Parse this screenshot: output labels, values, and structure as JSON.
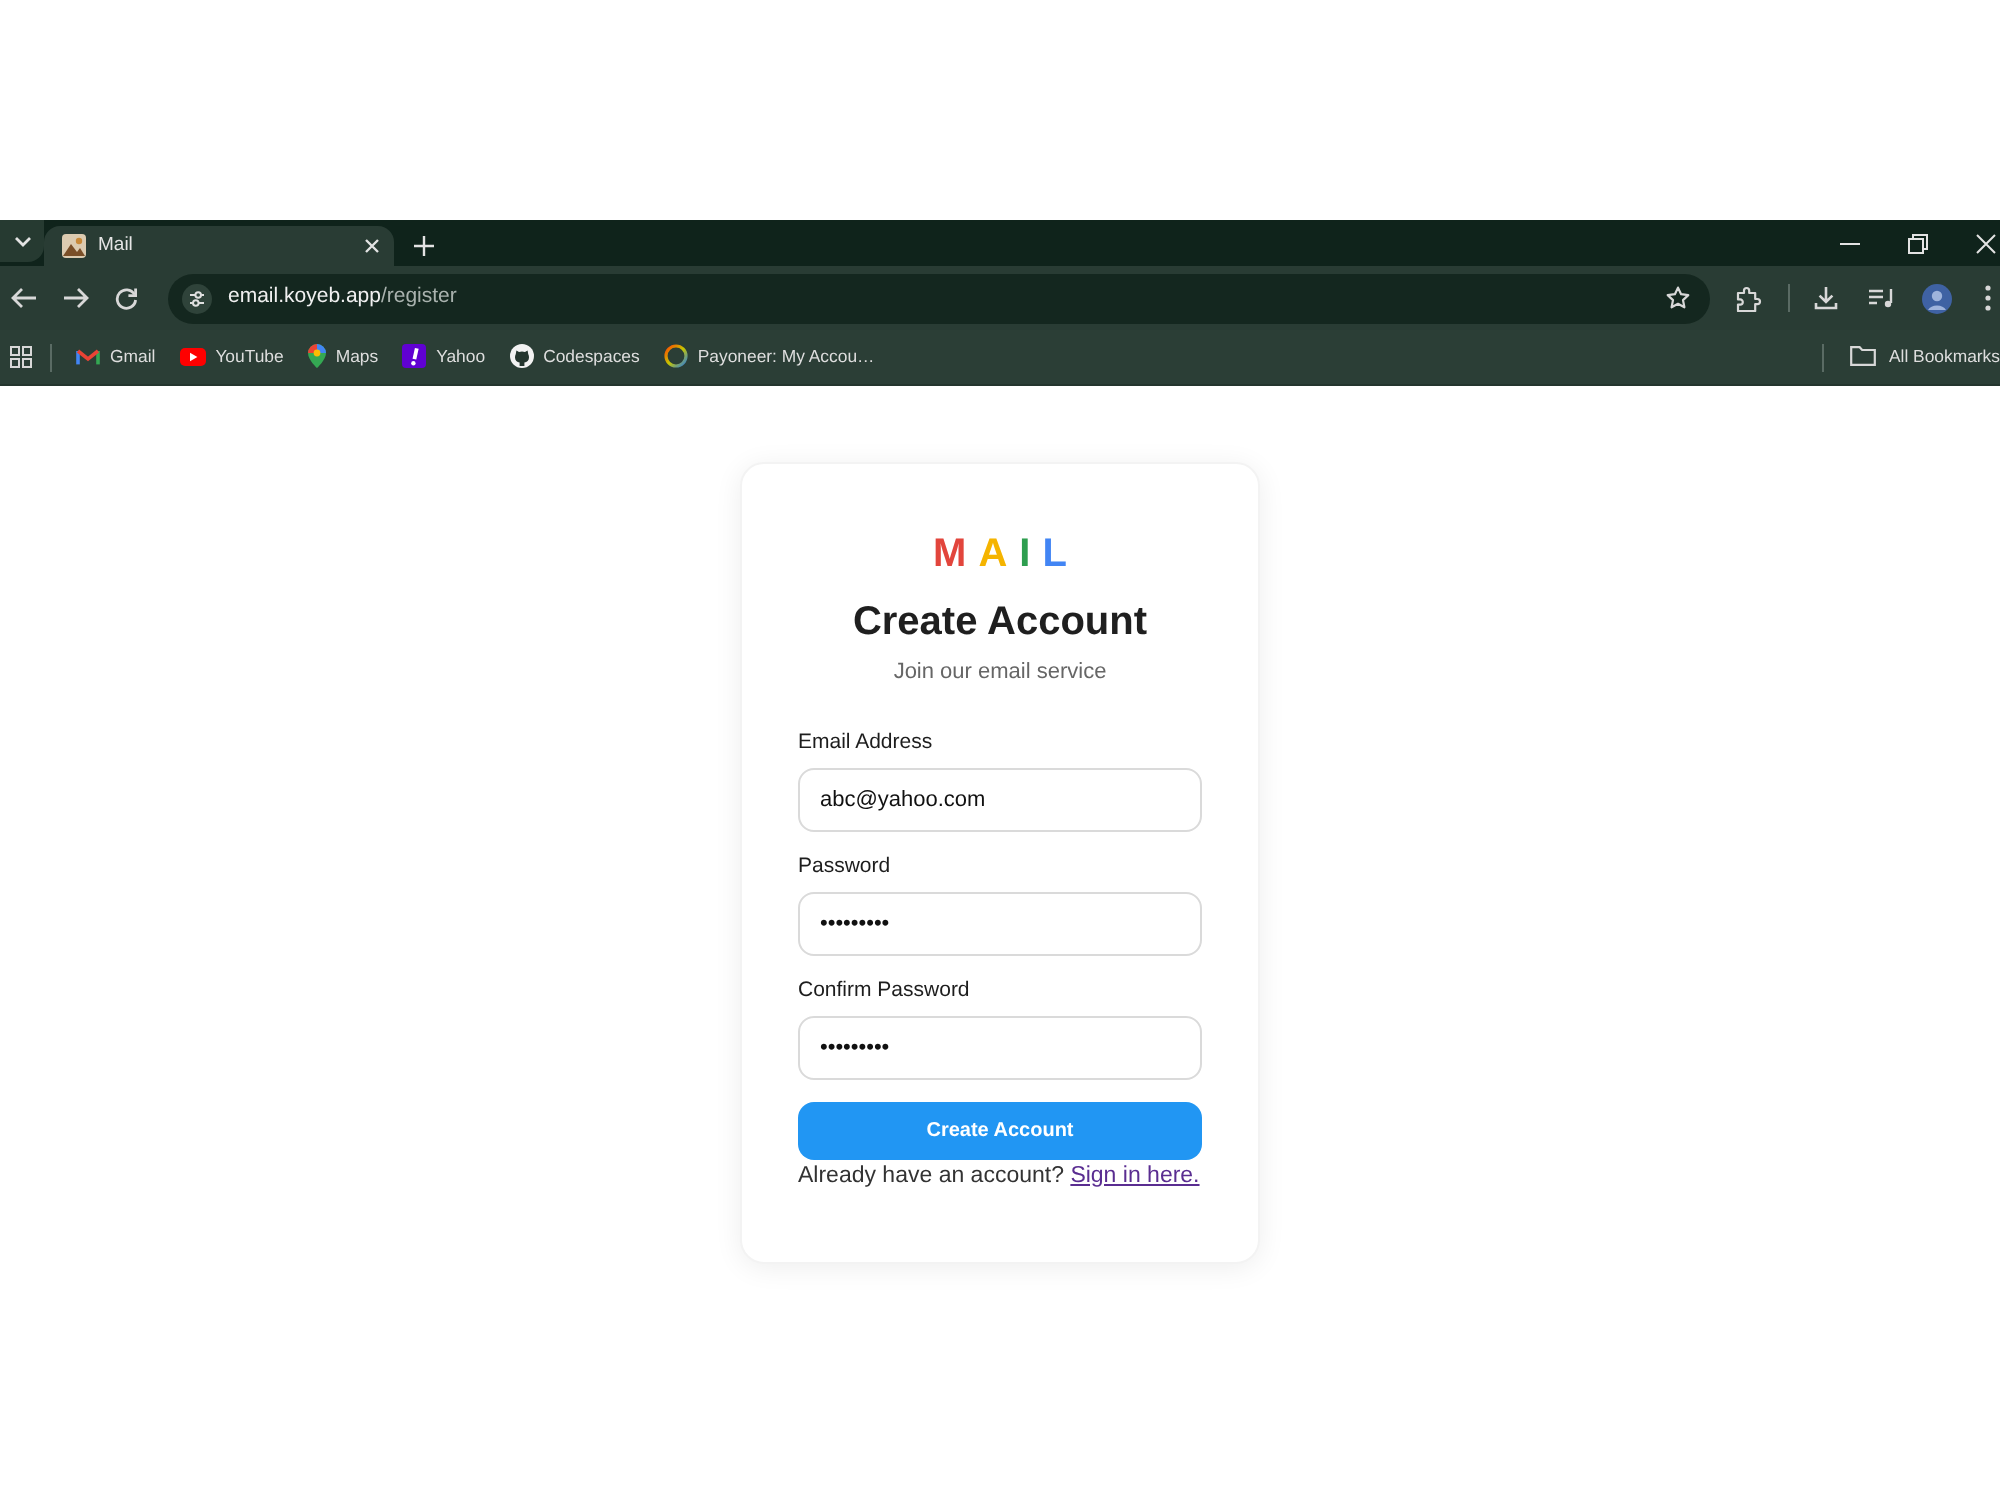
{
  "browser": {
    "tabs": [
      {
        "title": "Mail",
        "selected": true
      }
    ],
    "address": {
      "host": "email.koyeb.app",
      "path": "/register"
    },
    "bookmarks": [
      {
        "label": "Gmail"
      },
      {
        "label": "YouTube"
      },
      {
        "label": "Maps"
      },
      {
        "label": "Yahoo"
      },
      {
        "label": "Codespaces"
      },
      {
        "label": "Payoneer: My Accou…"
      }
    ],
    "all_bookmarks": "All Bookmarks"
  },
  "page": {
    "logo": [
      {
        "letter": "M",
        "color": "#e2453c"
      },
      {
        "letter": "A",
        "color": "#f5b400"
      },
      {
        "letter": "I",
        "color": "#2e9e4f"
      },
      {
        "letter": "L",
        "color": "#4285f4"
      }
    ],
    "title": "Create Account",
    "subtitle": "Join our email service",
    "fields": [
      {
        "label": "Email Address",
        "value": "abc@yahoo.com"
      },
      {
        "label": "Password",
        "value": "•••••••••"
      },
      {
        "label": "Confirm Password",
        "value": "•••••••••"
      }
    ],
    "submit": "Create Account",
    "footer": {
      "text": "Already have an account?",
      "link": "Sign in here.",
      "visited": true
    }
  }
}
